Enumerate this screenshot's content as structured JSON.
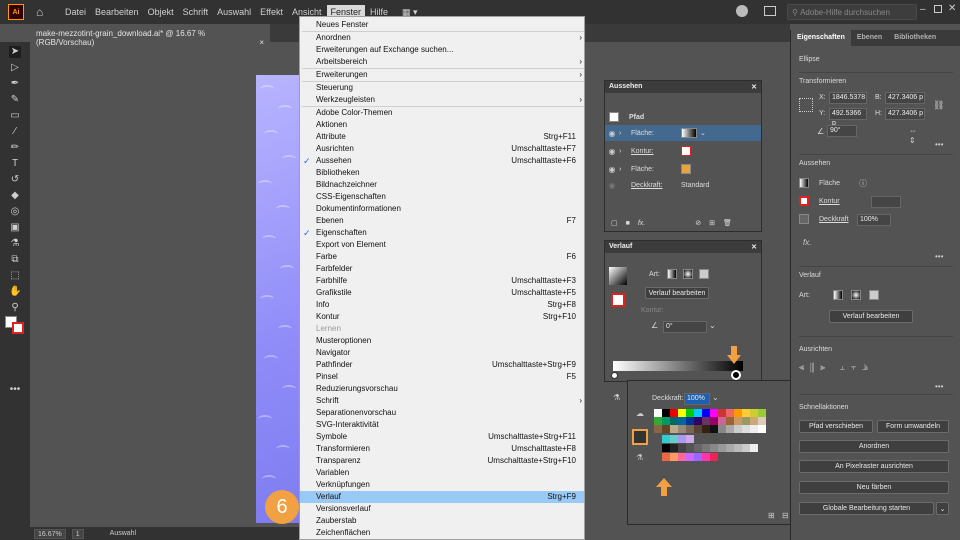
{
  "app": {
    "logo": "Ai"
  },
  "menubar": {
    "items": [
      "Datei",
      "Bearbeiten",
      "Objekt",
      "Schrift",
      "Auswahl",
      "Effekt",
      "Ansicht",
      "Fenster",
      "Hilfe"
    ],
    "search_placeholder": "Adobe-Hilfe durchsuchen"
  },
  "document": {
    "tab_title": "make-mezzotint-grain_download.ai* @ 16.67 % (RGB/Vorschau)",
    "close": "×"
  },
  "status": {
    "zoom": "16.67%",
    "page": "1",
    "mode": "Auswahl"
  },
  "step_badge": "6",
  "fenster_menu": [
    {
      "label": "Neues Fenster"
    },
    {
      "sep": true
    },
    {
      "label": "Anordnen",
      "submenu": true
    },
    {
      "label": "Erweiterungen auf Exchange suchen..."
    },
    {
      "label": "Arbeitsbereich",
      "submenu": true
    },
    {
      "sep": true
    },
    {
      "label": "Erweiterungen",
      "submenu": true
    },
    {
      "sep": true
    },
    {
      "label": "Steuerung"
    },
    {
      "label": "Werkzeugleisten",
      "submenu": true
    },
    {
      "sep": true
    },
    {
      "label": "Adobe Color-Themen"
    },
    {
      "label": "Aktionen"
    },
    {
      "label": "Attribute",
      "shortcut": "Strg+F11"
    },
    {
      "label": "Ausrichten",
      "shortcut": "Umschalttaste+F7"
    },
    {
      "label": "Aussehen",
      "shortcut": "Umschalttaste+F6",
      "checked": true
    },
    {
      "label": "Bibliotheken"
    },
    {
      "label": "Bildnachzeichner"
    },
    {
      "label": "CSS-Eigenschaften"
    },
    {
      "label": "Dokumentinformationen"
    },
    {
      "label": "Ebenen",
      "shortcut": "F7"
    },
    {
      "label": "Eigenschaften",
      "checked": true
    },
    {
      "label": "Export von Element"
    },
    {
      "label": "Farbe",
      "shortcut": "F6"
    },
    {
      "label": "Farbfelder"
    },
    {
      "label": "Farbhilfe",
      "shortcut": "Umschalttaste+F3"
    },
    {
      "label": "Grafikstile",
      "shortcut": "Umschalttaste+F5"
    },
    {
      "label": "Info",
      "shortcut": "Strg+F8"
    },
    {
      "label": "Kontur",
      "shortcut": "Strg+F10"
    },
    {
      "label": "Lernen",
      "disabled": true
    },
    {
      "label": "Musteroptionen"
    },
    {
      "label": "Navigator"
    },
    {
      "label": "Pathfinder",
      "shortcut": "Umschalttaste+Strg+F9"
    },
    {
      "label": "Pinsel",
      "shortcut": "F5"
    },
    {
      "label": "Reduzierungsvorschau"
    },
    {
      "label": "Schrift",
      "submenu": true
    },
    {
      "label": "Separationenvorschau"
    },
    {
      "label": "SVG-Interaktivität"
    },
    {
      "label": "Symbole",
      "shortcut": "Umschalttaste+Strg+F11"
    },
    {
      "label": "Transformieren",
      "shortcut": "Umschalttaste+F8"
    },
    {
      "label": "Transparenz",
      "shortcut": "Umschalttaste+Strg+F10"
    },
    {
      "label": "Variablen"
    },
    {
      "label": "Verknüpfungen"
    },
    {
      "label": "Verlauf",
      "shortcut": "Strg+F9",
      "highlighted": true
    },
    {
      "label": "Versionsverlauf"
    },
    {
      "label": "Zauberstab"
    },
    {
      "label": "Zeichenflächen"
    }
  ],
  "aussehen_panel": {
    "title": "Aussehen",
    "path_label": "Pfad",
    "rows": [
      {
        "label": "Fläche:"
      },
      {
        "label": "Kontur:"
      },
      {
        "label": "Fläche:"
      },
      {
        "label": "Deckkraft:",
        "value": "Standard"
      }
    ],
    "fx": "fx."
  },
  "verlauf_panel": {
    "title": "Verlauf",
    "art_label": "Art:",
    "edit_button": "Verlauf bearbeiten",
    "kontur_label": "Kontur:",
    "angle_value": "0°"
  },
  "picker": {
    "opacity_label": "Deckkraft:",
    "opacity_value": "100%"
  },
  "properties": {
    "tabs": [
      "Eigenschaften",
      "Ebenen",
      "Bibliotheken"
    ],
    "object": "Ellipse",
    "transform_title": "Transformieren",
    "x_label": "X:",
    "x_value": "1846.5378",
    "y_label": "Y:",
    "y_value": "492.5366 p",
    "b_label": "B:",
    "b_value": "427.3406 p",
    "h_label": "H:",
    "h_value": "427.3406 p",
    "angle": "90°",
    "aussehen_title": "Aussehen",
    "flaeche": "Fläche",
    "kontur": "Kontur",
    "deckkraft": "Deckkraft",
    "deckkraft_value": "100%",
    "fx": "fx.",
    "verlauf_title": "Verlauf",
    "art_label": "Art:",
    "edit_button": "Verlauf bearbeiten",
    "ausrichten_title": "Ausrichten",
    "quick_title": "Schnellaktionen",
    "quick_buttons": [
      "Pfad verschieben",
      "Form umwandeln",
      "Anordnen",
      "An Pixelraster ausrichten",
      "Neu färben",
      "Globale Bearbeitung starten"
    ]
  },
  "colors": {
    "accent": "#f1a042",
    "menu_highlight": "#99c9f5",
    "check": "#1473e6"
  }
}
